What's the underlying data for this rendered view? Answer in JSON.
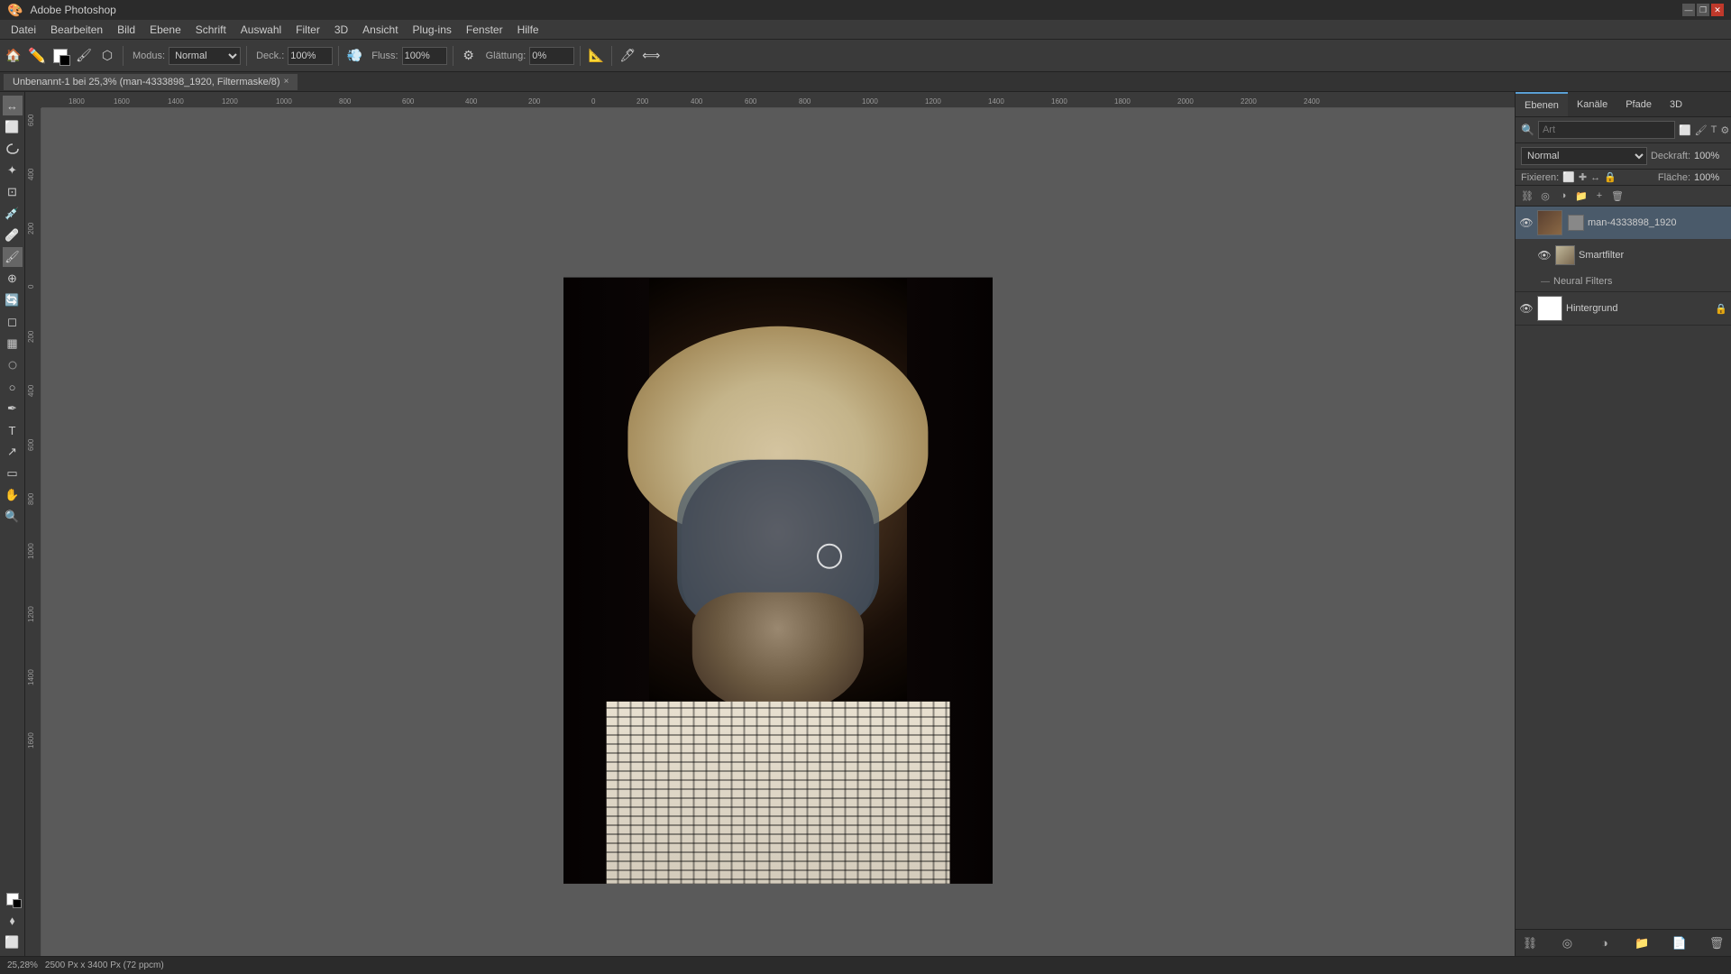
{
  "titlebar": {
    "title": "Adobe Photoshop",
    "min_btn": "—",
    "max_btn": "❐",
    "close_btn": "✕"
  },
  "menubar": {
    "items": [
      "Datei",
      "Bearbeiten",
      "Bild",
      "Ebene",
      "Schrift",
      "Auswahl",
      "Filter",
      "3D",
      "Ansicht",
      "Plug-ins",
      "Fenster",
      "Hilfe"
    ]
  },
  "toolbar": {
    "modus_label": "Modus:",
    "modus_value": "Normal",
    "deck_label": "Deck.:",
    "deck_value": "100%",
    "fluss_label": "Fluss:",
    "fluss_value": "100%",
    "glaettung_label": "Glättung:",
    "glaettung_value": "0%"
  },
  "tabbar": {
    "tab_name": "Unbenannt-1 bei 25,3% (man-4333898_1920, Filtermaske/8)",
    "tab_close": "×"
  },
  "canvas": {
    "zoom_level": "25,28%",
    "image_info": "2500 Px x 3400 Px (72 ppcm)"
  },
  "right_panel": {
    "tabs": [
      "Ebenen",
      "Kanäle",
      "Pfade",
      "3D"
    ],
    "active_tab": "Ebenen",
    "search_placeholder": "Art",
    "blend_mode": "Normal",
    "deckkraft_label": "Deckraft:",
    "deckkraft_value": "100%",
    "fixieren_label": "Fixieren:",
    "flaeche_label": "Fläche:",
    "flaeche_value": "100%",
    "layers": [
      {
        "id": "man-layer",
        "name": "man-4333898_1920",
        "visible": true,
        "locked": false,
        "selected": true,
        "thumb_class": "lt-man",
        "has_mask": true,
        "sublayers": [
          {
            "id": "smartfilter",
            "name": "Smartfilter",
            "visible": true,
            "thumb_class": "lt-smartfilter"
          },
          {
            "id": "neural-filters",
            "name": "Neural Filters",
            "type": "neural"
          }
        ]
      },
      {
        "id": "hintergrund",
        "name": "Hintergrund",
        "visible": true,
        "locked": true,
        "thumb_class": "lt-white"
      }
    ]
  },
  "statusbar": {
    "zoom": "25,28%",
    "info": "2500 Px x 3400 Px (72 ppcm)"
  },
  "icons": {
    "eye": "👁",
    "lock": "🔒",
    "search": "🔍",
    "folder": "📁",
    "link": "🔗",
    "arrow_right": "▶",
    "arrow_down": "▼"
  }
}
